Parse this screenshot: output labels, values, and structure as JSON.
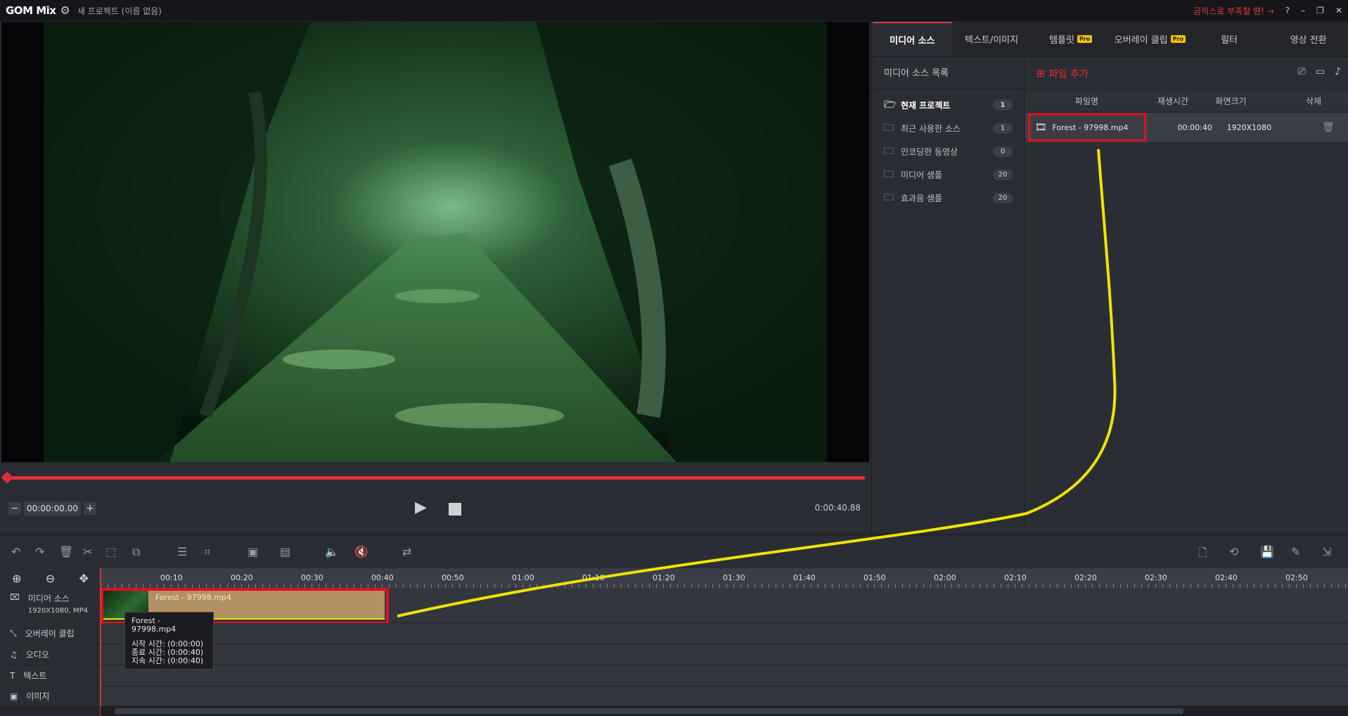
{
  "app": {
    "logo": "GOM Mix",
    "project": "새 프로젝트 (이름 없음)",
    "promo": "곰믹스로 부족할 땐! →",
    "help": "?"
  },
  "preview": {
    "time": "00:00:00.00",
    "duration": "0:00:40.88",
    "minus": "−",
    "plus": "+"
  },
  "tabs": [
    {
      "label": "미디어 소스",
      "active": true
    },
    {
      "label": "텍스트/이미지"
    },
    {
      "label": "템플릿",
      "pro": "Pro"
    },
    {
      "label": "오버레이 클립",
      "pro": "Pro"
    },
    {
      "label": "필터"
    },
    {
      "label": "영상 전환"
    }
  ],
  "source_list": {
    "title": "미디어 소스 목록",
    "items": [
      {
        "label": "현재 프로젝트",
        "count": "1"
      },
      {
        "label": "최근 사용한 소스",
        "count": "1"
      },
      {
        "label": "인코딩한 동영상",
        "count": "0"
      },
      {
        "label": "미디어 샘플",
        "count": "20"
      },
      {
        "label": "효과음 샘플",
        "count": "20"
      }
    ]
  },
  "files": {
    "add_label": "파일 추가",
    "headers": {
      "name": "파일명",
      "duration": "재생시간",
      "size": "화면크기",
      "delete": "삭제"
    },
    "rows": [
      {
        "name": "Forest - 97998.mp4",
        "duration": "00:00:40",
        "size": "1920X1080"
      }
    ]
  },
  "ruler": [
    "00:10",
    "00:20",
    "00:30",
    "00:40",
    "00:50",
    "01:00",
    "01:10",
    "01:20",
    "01:30",
    "01:40",
    "01:50",
    "02:00",
    "02:10",
    "02:20",
    "02:30",
    "02:40",
    "02:50"
  ],
  "tracks": {
    "media": {
      "label": "미디어 소스",
      "sub": "1920X1080, MP4"
    },
    "overlay": "오버레이 클립",
    "audio": "오디오",
    "text": "텍스트",
    "image": "이미지"
  },
  "clip": {
    "name": "Forest - 97998.mp4"
  },
  "tooltip": {
    "title": "Forest - 97998.mp4",
    "start": "시작 시간: (0:00:00)",
    "end": "종료 시간: (0:00:40)",
    "length": "지속 시간: (0:00:40)"
  },
  "colors": {
    "accent": "#e0313c",
    "annotation": "#f2e200",
    "highlight": "#e0101e"
  }
}
